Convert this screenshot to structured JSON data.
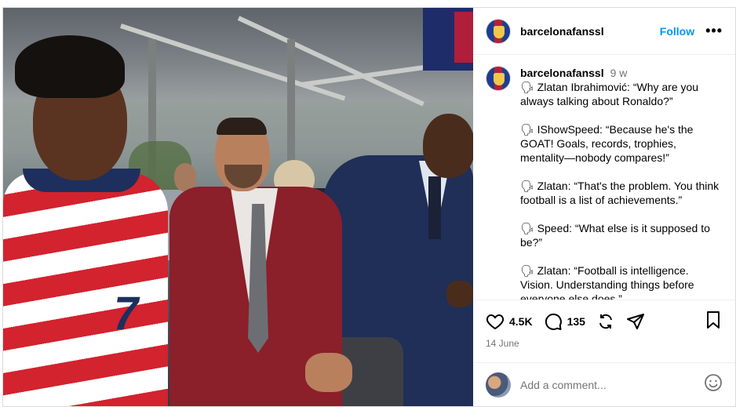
{
  "post": {
    "author": "barcelonafanssl",
    "follow_label": "Follow",
    "more_label": "•••",
    "caption": {
      "username": "barcelonafanssl",
      "time_ago": "9 w",
      "paragraphs": [
        "🗣 Zlatan Ibrahimović: “Why are you always talking about Ronaldo?”",
        "🗣 IShowSpeed: “Because he's the GOAT! Goals, records, trophies, mentality—nobody compares!”",
        "🗣 Zlatan: “That's the problem. You think football is a list of achievements.”",
        "🗣 Speed: “What else is it supposed to be?”",
        "🗣 Zlatan: “Football is intelligence. Vision. Understanding things before everyone else does.”"
      ]
    },
    "likes": "4.5K",
    "comments_count": "135",
    "date": "14 June",
    "comment_placeholder": "Add a comment...",
    "jersey_number": "7",
    "icons": {
      "like": "heart-icon",
      "comment": "comment-icon",
      "repost": "repost-icon",
      "share": "share-icon",
      "save": "bookmark-icon",
      "emoji": "emoji-icon"
    },
    "colors": {
      "follow": "#0095f6",
      "muted": "#737373",
      "border": "#dbdbdb"
    }
  }
}
